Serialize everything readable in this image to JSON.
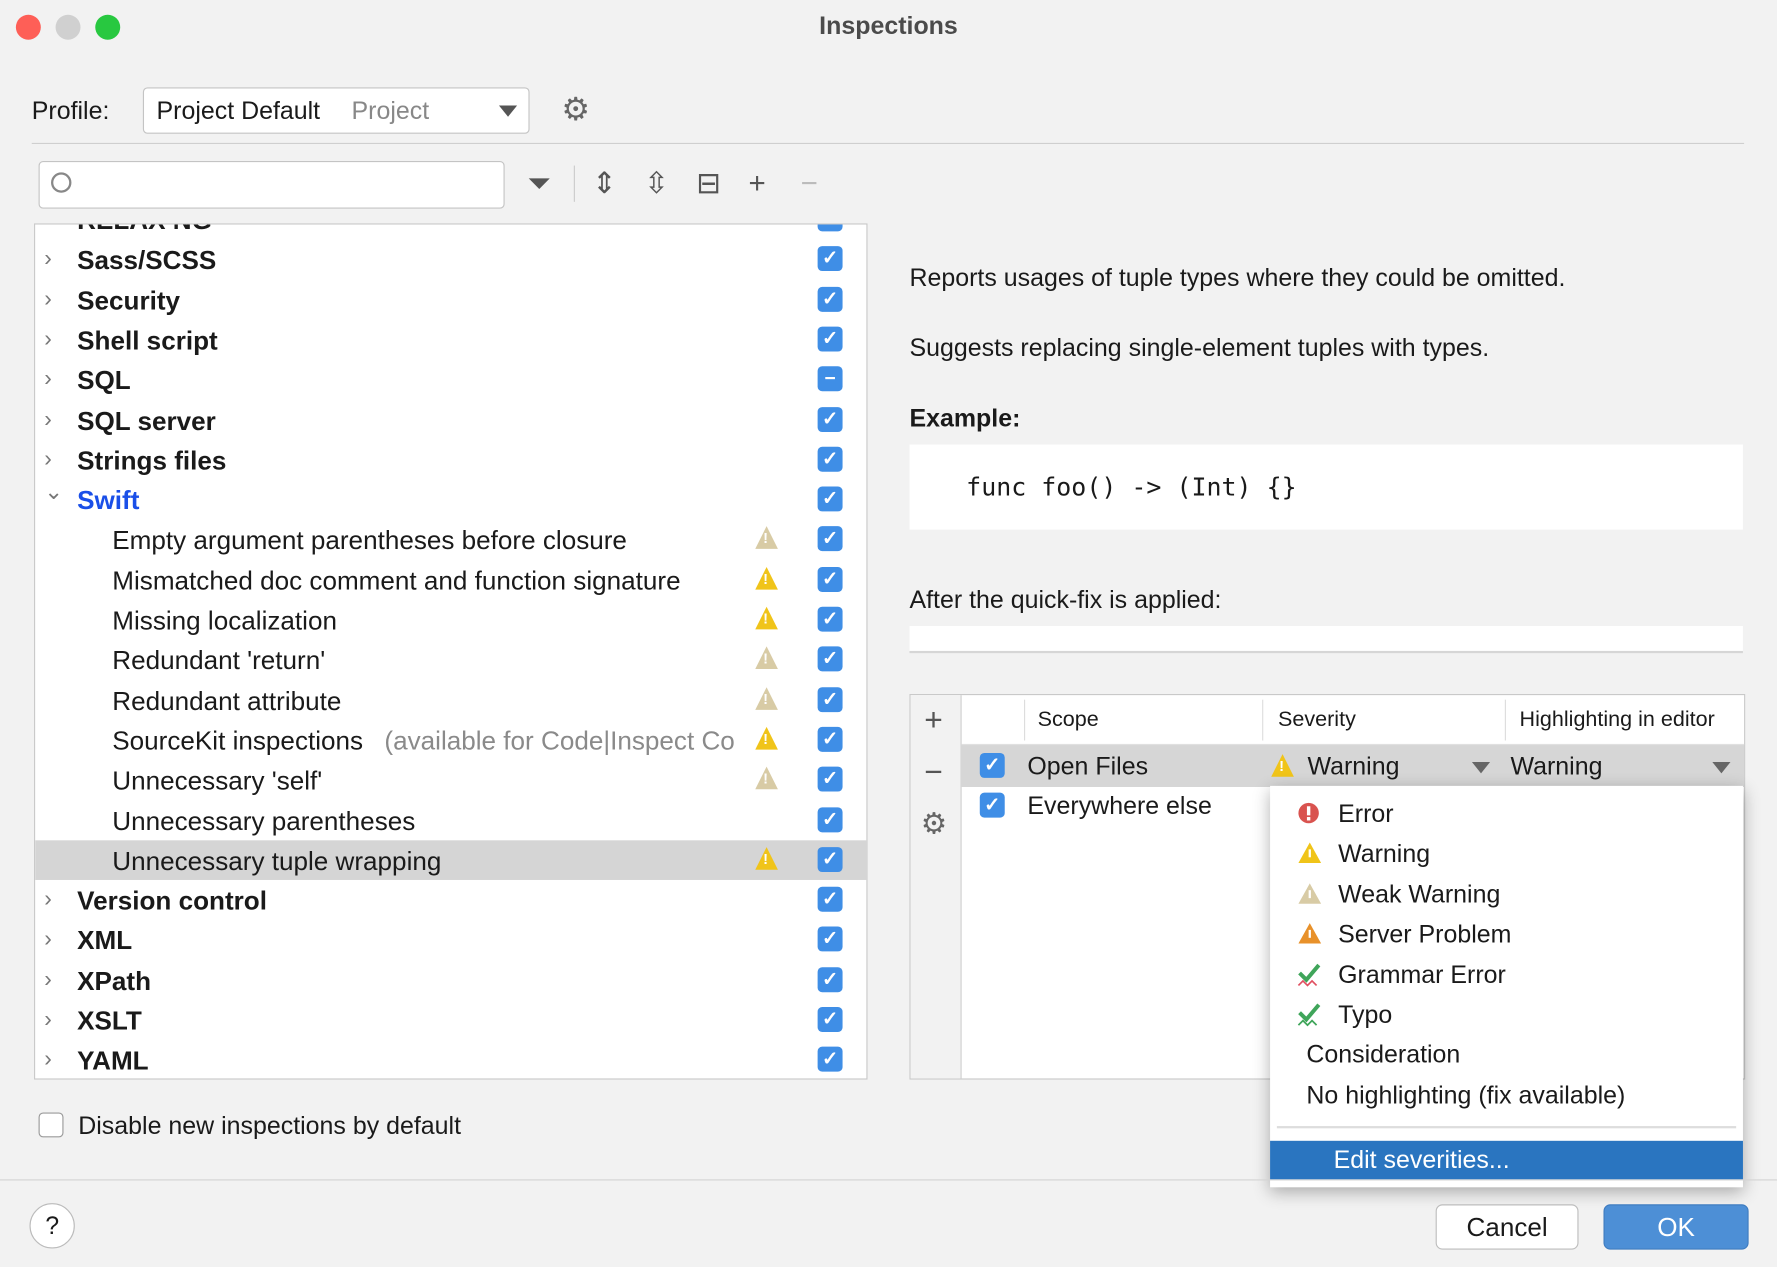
{
  "window": {
    "title": "Inspections"
  },
  "profile": {
    "label": "Profile:",
    "name": "Project Default",
    "scope": "Project"
  },
  "search": {
    "value": "",
    "placeholder": ""
  },
  "tree": {
    "partial_top": "RELAX NG",
    "groups_before": [
      {
        "label": "Sass/SCSS",
        "state": "checked"
      },
      {
        "label": "Security",
        "state": "checked"
      },
      {
        "label": "Shell script",
        "state": "checked"
      },
      {
        "label": "SQL",
        "state": "mixed"
      },
      {
        "label": "SQL server",
        "state": "checked"
      },
      {
        "label": "Strings files",
        "state": "checked"
      }
    ],
    "expanded": {
      "label": "Swift",
      "state": "checked"
    },
    "children": [
      {
        "label": "Empty argument parentheses before closure",
        "severity": "weak"
      },
      {
        "label": "Mismatched doc comment and function signature",
        "severity": "warning"
      },
      {
        "label": "Missing localization",
        "severity": "warning"
      },
      {
        "label": "Redundant 'return'",
        "severity": "weak"
      },
      {
        "label": "Redundant attribute",
        "severity": "weak"
      },
      {
        "label": "SourceKit inspections",
        "note": "(available for Code|Inspect Co",
        "severity": "warning"
      },
      {
        "label": "Unnecessary 'self'",
        "severity": "weak"
      },
      {
        "label": "Unnecessary parentheses",
        "severity": "none"
      },
      {
        "label": "Unnecessary tuple wrapping",
        "severity": "warning",
        "selected": true
      }
    ],
    "groups_after": [
      {
        "label": "Version control"
      },
      {
        "label": "XML"
      },
      {
        "label": "XPath"
      },
      {
        "label": "XSLT"
      },
      {
        "label": "YAML"
      }
    ]
  },
  "description": {
    "line1": "Reports usages of tuple types where they could be omitted.",
    "line2": "Suggests replacing single-element tuples with types.",
    "example_label": "Example:",
    "code": "func foo() -> (Int) {}",
    "after_label": "After the quick-fix is applied:"
  },
  "scopes": {
    "headers": [
      "Scope",
      "Severity",
      "Highlighting in editor"
    ],
    "rows": [
      {
        "scope": "Open Files",
        "severity": "Warning",
        "highlighting": "Warning"
      },
      {
        "scope": "Everywhere else"
      }
    ]
  },
  "menu": {
    "items": [
      {
        "label": "Error",
        "icon": "error-icon"
      },
      {
        "label": "Warning",
        "icon": "warning-icon"
      },
      {
        "label": "Weak Warning",
        "icon": "weak-warning-icon"
      },
      {
        "label": "Server Problem",
        "icon": "server-problem-icon"
      },
      {
        "label": "Grammar Error",
        "icon": "grammar-icon"
      },
      {
        "label": "Typo",
        "icon": "typo-icon"
      },
      {
        "label": "Consideration"
      },
      {
        "label": "No highlighting (fix available)"
      }
    ],
    "edit": "Edit severities..."
  },
  "footer": {
    "disable_label": "Disable new inspections by default",
    "help": "?",
    "cancel": "Cancel",
    "ok": "OK"
  },
  "colors": {
    "accent": "#3f8ee6",
    "selection": "#2a75c0",
    "warning": "#f0c419",
    "weak": "#d8cba5",
    "server": "#e8912a",
    "error": "#d9534f"
  }
}
